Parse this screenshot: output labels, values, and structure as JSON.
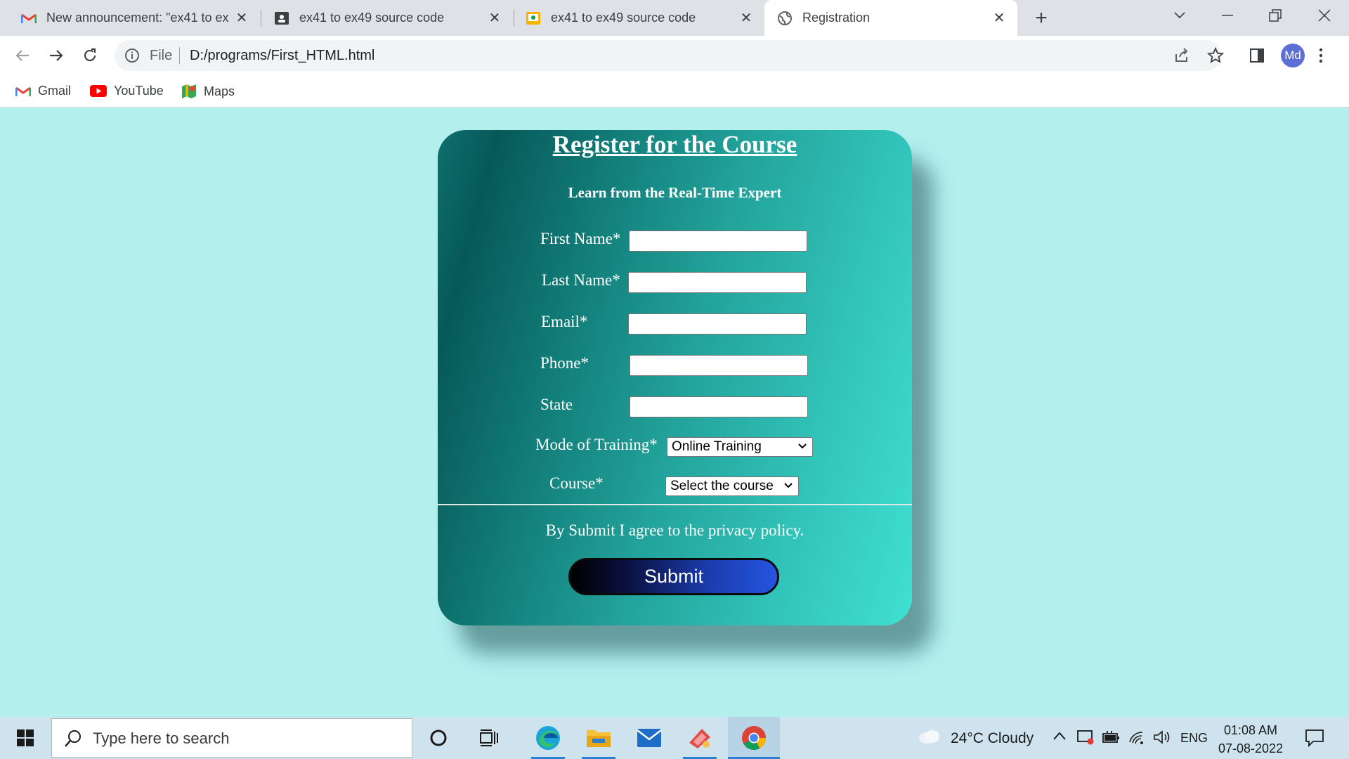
{
  "browser": {
    "tabs": [
      {
        "title": "New announcement: \"ex41 to ex",
        "icon": "gmail-icon"
      },
      {
        "title": "ex41 to ex49 source code",
        "icon": "classroom-icon"
      },
      {
        "title": "ex41 to ex49 source code",
        "icon": "slides-icon"
      },
      {
        "title": "Registration",
        "icon": "globe-icon"
      }
    ],
    "address": {
      "scheme_label": "File",
      "url": "D:/programs/First_HTML.html"
    },
    "profile_initials": "Md",
    "bookmarks": [
      {
        "label": "Gmail",
        "icon": "gmail-icon"
      },
      {
        "label": "YouTube",
        "icon": "youtube-icon"
      },
      {
        "label": "Maps",
        "icon": "maps-icon"
      }
    ]
  },
  "form": {
    "title": "Register for the Course",
    "subtitle": "Learn from the Real-Time Expert",
    "fields": {
      "first_name": {
        "label": "First Name*",
        "value": ""
      },
      "last_name": {
        "label": "Last Name*",
        "value": ""
      },
      "email": {
        "label": "Email*",
        "value": ""
      },
      "phone": {
        "label": "Phone*",
        "value": ""
      },
      "state": {
        "label": "State",
        "value": ""
      }
    },
    "mode_of_training": {
      "label": "Mode of Training*",
      "selected": "Online Training"
    },
    "course": {
      "label": "Course*",
      "selected": "Select the course"
    },
    "policy_text": "By Submit I agree to the privacy policy.",
    "submit_label": "Submit",
    "colors": {
      "card_dark": "#075959",
      "card_light": "#3fe0d2",
      "page_bg": "#b2efed",
      "button_blue": "#2555e2"
    }
  },
  "taskbar": {
    "search_placeholder": "Type here to search",
    "weather": "24°C  Cloudy",
    "language": "ENG",
    "time": "01:08 AM",
    "date": "07-08-2022"
  }
}
